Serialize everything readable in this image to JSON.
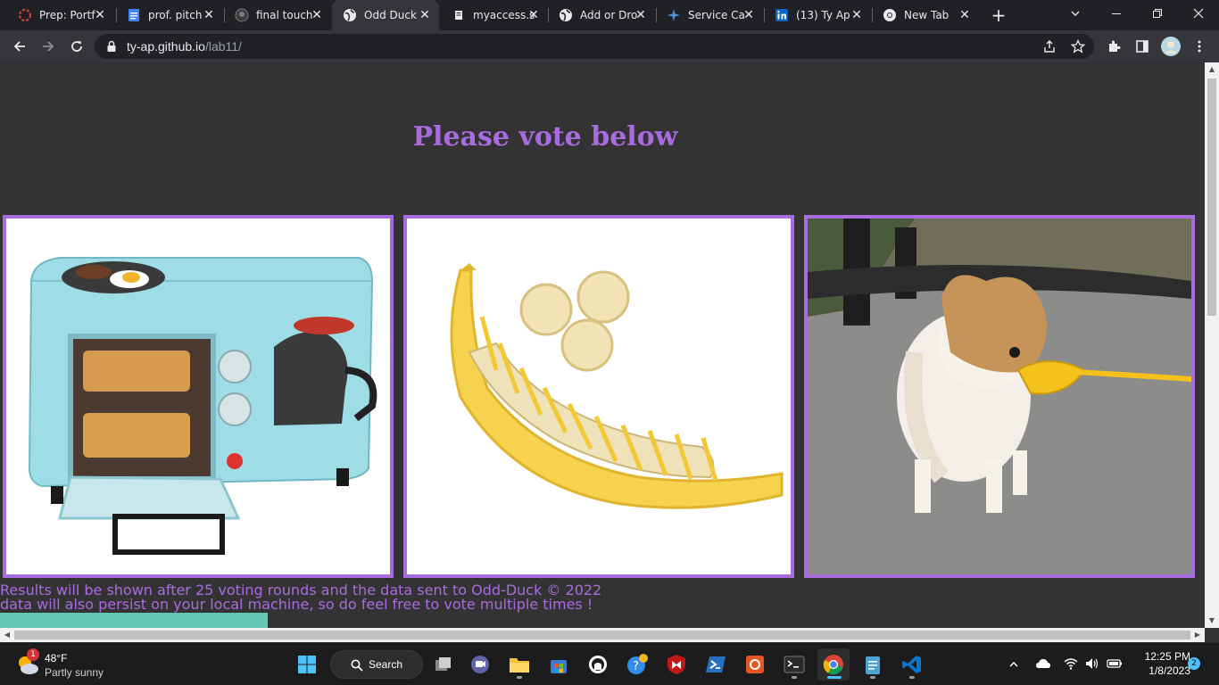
{
  "tabs": [
    {
      "title": "Prep: Portf",
      "icon": "settings-ring-icon"
    },
    {
      "title": "prof. pitch",
      "icon": "google-docs-icon"
    },
    {
      "title": "final touch",
      "icon": "github-icon"
    },
    {
      "title": "Odd Duck",
      "icon": "globe-icon"
    },
    {
      "title": "myaccess.s",
      "icon": "document-icon"
    },
    {
      "title": "Add or Dro",
      "icon": "globe-icon"
    },
    {
      "title": "Service Ca",
      "icon": "star-logo-icon"
    },
    {
      "title": "(13) Ty Ap",
      "icon": "linkedin-icon"
    },
    {
      "title": "New Tab",
      "icon": "chrome-icon"
    }
  ],
  "address_bar": {
    "host": "ty-ap.github.io",
    "path": "/lab11/"
  },
  "page": {
    "title": "Please vote below",
    "images": [
      {
        "alt": "breakfast maker"
      },
      {
        "alt": "banana slicer"
      },
      {
        "alt": "dog duck muzzle"
      }
    ],
    "footer_line1": "Results will be shown after 25 voting rounds and the data sent to Odd-Duck © 2022",
    "footer_line2": "data will also persist on your local machine, so do feel free to vote multiple times !"
  },
  "taskbar": {
    "weather_temp": "48°F",
    "weather_desc": "Partly sunny",
    "weather_badge": "1",
    "search_label": "Search",
    "time": "12:25 PM",
    "date": "1/8/2023",
    "notification_count": "2"
  },
  "colors": {
    "accent": "#a86be0",
    "page_bg": "#333333",
    "teal": "#64c8b4"
  }
}
